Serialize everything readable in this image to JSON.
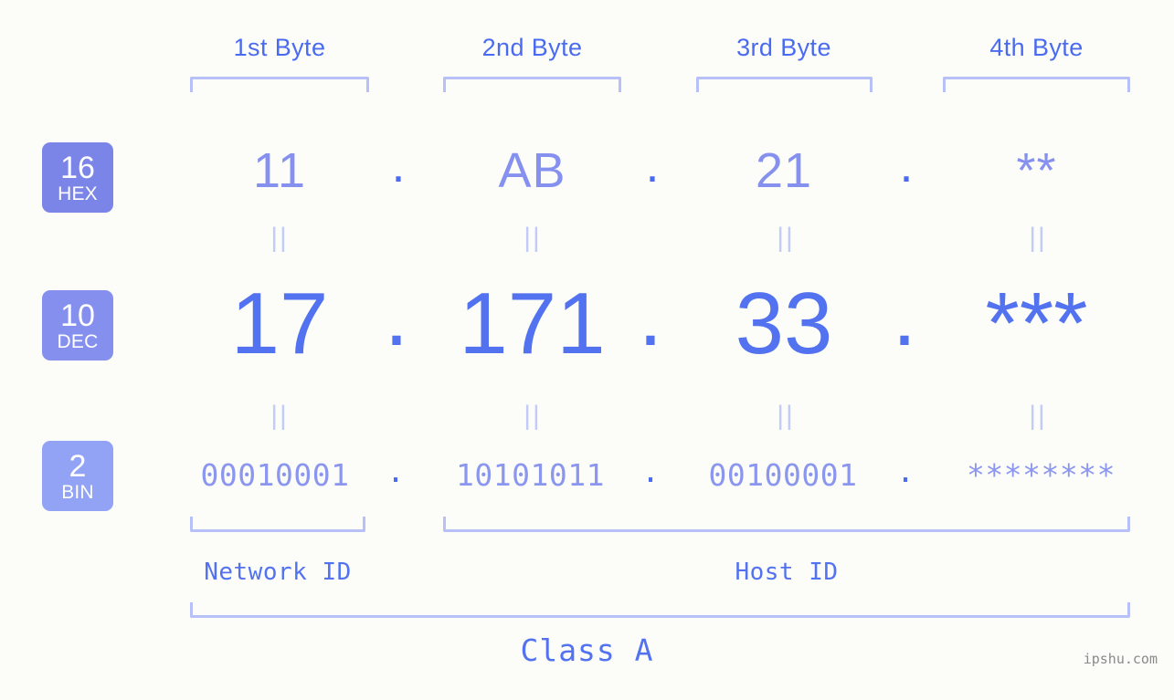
{
  "meta": {
    "background_color": "#fcfdf9",
    "accent_color": "#5272ef",
    "light_accent_color": "#8691ef",
    "bracket_color": "#b7c1f7",
    "watermark": "ipshu.com"
  },
  "byte_headers": [
    {
      "label": "1st Byte"
    },
    {
      "label": "2nd Byte"
    },
    {
      "label": "3rd Byte"
    },
    {
      "label": "4th Byte"
    }
  ],
  "rows": [
    {
      "badge_number": "16",
      "badge_name": "HEX",
      "badge_color": "#7b85e8",
      "values": [
        "11",
        "AB",
        "21",
        "**"
      ],
      "separator": "."
    },
    {
      "badge_number": "10",
      "badge_name": "DEC",
      "badge_color": "#8590ee",
      "values": [
        "17",
        "171",
        "33",
        "***"
      ],
      "separator": "."
    },
    {
      "badge_number": "2",
      "badge_name": "BIN",
      "badge_color": "#92a3f5",
      "values": [
        "00010001",
        "10101011",
        "00100001",
        "********"
      ],
      "separator": "."
    }
  ],
  "equality_markers": {
    "glyph": "||",
    "count_per_row": 4
  },
  "id_sections": [
    {
      "label": "Network ID"
    },
    {
      "label": "Host ID"
    }
  ],
  "class_label": "Class A"
}
